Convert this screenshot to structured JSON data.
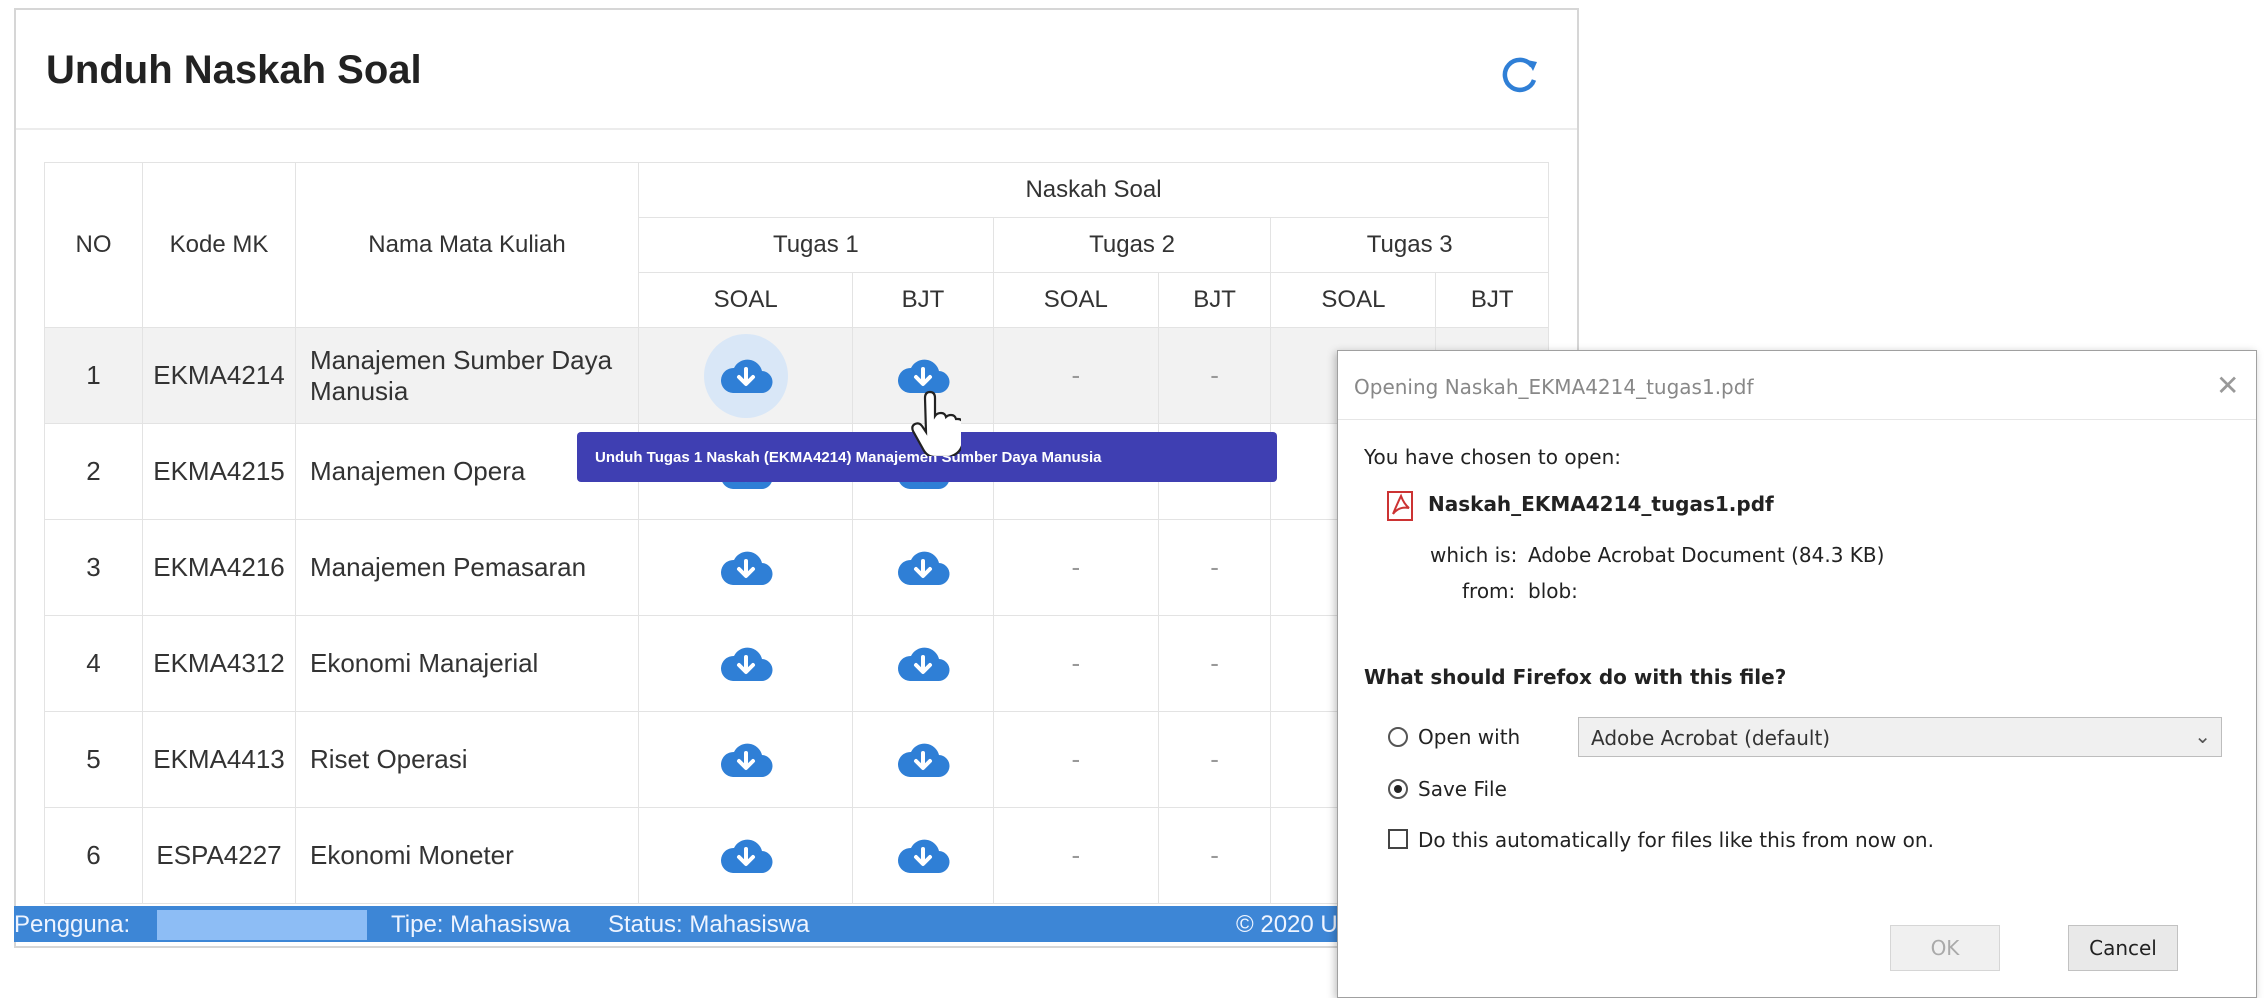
{
  "panel": {
    "title": "Unduh Naskah Soal",
    "refresh_icon": "refresh-icon"
  },
  "table": {
    "headers": {
      "no": "NO",
      "kode": "Kode MK",
      "nama": "Nama Mata Kuliah",
      "naskah": "Naskah Soal",
      "tugas1": "Tugas 1",
      "tugas2": "Tugas 2",
      "tugas3": "Tugas 3",
      "soal": "SOAL",
      "bjt": "BJT"
    },
    "rows": [
      {
        "no": "1",
        "kode": "EKMA4214",
        "nama": "Manajemen Sumber Daya Manusia",
        "dash": "-"
      },
      {
        "no": "2",
        "kode": "EKMA4215",
        "nama": "Manajemen Opera",
        "dash": "-"
      },
      {
        "no": "3",
        "kode": "EKMA4216",
        "nama": "Manajemen Pemasaran",
        "dash": "-"
      },
      {
        "no": "4",
        "kode": "EKMA4312",
        "nama": "Ekonomi Manajerial",
        "dash": "-"
      },
      {
        "no": "5",
        "kode": "EKMA4413",
        "nama": "Riset Operasi",
        "dash": "-"
      },
      {
        "no": "6",
        "kode": "ESPA4227",
        "nama": "Ekonomi Moneter",
        "dash": "-"
      }
    ]
  },
  "tooltip": "Unduh Tugas 1 Naskah (EKMA4214) Manajemen Sumber Daya Manusia",
  "footer": {
    "pengguna": "Pengguna:",
    "tipe": "Tipe: Mahasiswa",
    "status": "Status: Mahasiswa",
    "copyright": "© 2020 U"
  },
  "dialog": {
    "title": "Opening Naskah_EKMA4214_tugas1.pdf",
    "chosen": "You have chosen to open:",
    "filename": "Naskah_EKMA4214_tugas1.pdf",
    "which_label": "which is:",
    "which_value": "Adobe Acrobat Document (84.3 KB)",
    "from_label": "from:",
    "from_value": "blob:",
    "question": "What should Firefox do with this file?",
    "open_with": "Open with",
    "open_with_app": "Adobe Acrobat (default)",
    "save_file": "Save File",
    "auto": "Do this automatically for files like this from now on.",
    "ok": "OK",
    "cancel": "Cancel"
  },
  "colors": {
    "accent": "#2f7fd6",
    "footer": "#3d86d6",
    "tooltip": "#3f3fb2"
  }
}
